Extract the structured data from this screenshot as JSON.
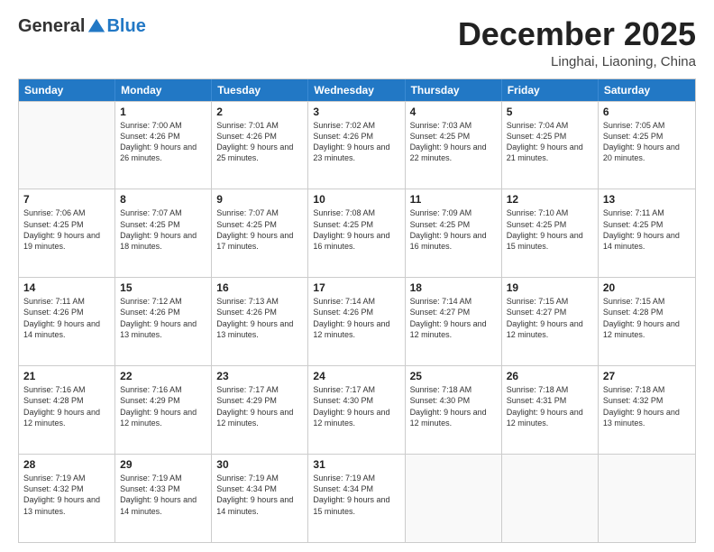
{
  "header": {
    "logo": {
      "general": "General",
      "blue": "Blue"
    },
    "title": "December 2025",
    "location": "Linghai, Liaoning, China"
  },
  "weekdays": [
    "Sunday",
    "Monday",
    "Tuesday",
    "Wednesday",
    "Thursday",
    "Friday",
    "Saturday"
  ],
  "weeks": [
    [
      {
        "day": null
      },
      {
        "day": "1",
        "sunrise": "7:00 AM",
        "sunset": "4:26 PM",
        "daylight": "9 hours and 26 minutes."
      },
      {
        "day": "2",
        "sunrise": "7:01 AM",
        "sunset": "4:26 PM",
        "daylight": "9 hours and 25 minutes."
      },
      {
        "day": "3",
        "sunrise": "7:02 AM",
        "sunset": "4:26 PM",
        "daylight": "9 hours and 23 minutes."
      },
      {
        "day": "4",
        "sunrise": "7:03 AM",
        "sunset": "4:25 PM",
        "daylight": "9 hours and 22 minutes."
      },
      {
        "day": "5",
        "sunrise": "7:04 AM",
        "sunset": "4:25 PM",
        "daylight": "9 hours and 21 minutes."
      },
      {
        "day": "6",
        "sunrise": "7:05 AM",
        "sunset": "4:25 PM",
        "daylight": "9 hours and 20 minutes."
      }
    ],
    [
      {
        "day": "7",
        "sunrise": "7:06 AM",
        "sunset": "4:25 PM",
        "daylight": "9 hours and 19 minutes."
      },
      {
        "day": "8",
        "sunrise": "7:07 AM",
        "sunset": "4:25 PM",
        "daylight": "9 hours and 18 minutes."
      },
      {
        "day": "9",
        "sunrise": "7:07 AM",
        "sunset": "4:25 PM",
        "daylight": "9 hours and 17 minutes."
      },
      {
        "day": "10",
        "sunrise": "7:08 AM",
        "sunset": "4:25 PM",
        "daylight": "9 hours and 16 minutes."
      },
      {
        "day": "11",
        "sunrise": "7:09 AM",
        "sunset": "4:25 PM",
        "daylight": "9 hours and 16 minutes."
      },
      {
        "day": "12",
        "sunrise": "7:10 AM",
        "sunset": "4:25 PM",
        "daylight": "9 hours and 15 minutes."
      },
      {
        "day": "13",
        "sunrise": "7:11 AM",
        "sunset": "4:25 PM",
        "daylight": "9 hours and 14 minutes."
      }
    ],
    [
      {
        "day": "14",
        "sunrise": "7:11 AM",
        "sunset": "4:26 PM",
        "daylight": "9 hours and 14 minutes."
      },
      {
        "day": "15",
        "sunrise": "7:12 AM",
        "sunset": "4:26 PM",
        "daylight": "9 hours and 13 minutes."
      },
      {
        "day": "16",
        "sunrise": "7:13 AM",
        "sunset": "4:26 PM",
        "daylight": "9 hours and 13 minutes."
      },
      {
        "day": "17",
        "sunrise": "7:14 AM",
        "sunset": "4:26 PM",
        "daylight": "9 hours and 12 minutes."
      },
      {
        "day": "18",
        "sunrise": "7:14 AM",
        "sunset": "4:27 PM",
        "daylight": "9 hours and 12 minutes."
      },
      {
        "day": "19",
        "sunrise": "7:15 AM",
        "sunset": "4:27 PM",
        "daylight": "9 hours and 12 minutes."
      },
      {
        "day": "20",
        "sunrise": "7:15 AM",
        "sunset": "4:28 PM",
        "daylight": "9 hours and 12 minutes."
      }
    ],
    [
      {
        "day": "21",
        "sunrise": "7:16 AM",
        "sunset": "4:28 PM",
        "daylight": "9 hours and 12 minutes."
      },
      {
        "day": "22",
        "sunrise": "7:16 AM",
        "sunset": "4:29 PM",
        "daylight": "9 hours and 12 minutes."
      },
      {
        "day": "23",
        "sunrise": "7:17 AM",
        "sunset": "4:29 PM",
        "daylight": "9 hours and 12 minutes."
      },
      {
        "day": "24",
        "sunrise": "7:17 AM",
        "sunset": "4:30 PM",
        "daylight": "9 hours and 12 minutes."
      },
      {
        "day": "25",
        "sunrise": "7:18 AM",
        "sunset": "4:30 PM",
        "daylight": "9 hours and 12 minutes."
      },
      {
        "day": "26",
        "sunrise": "7:18 AM",
        "sunset": "4:31 PM",
        "daylight": "9 hours and 12 minutes."
      },
      {
        "day": "27",
        "sunrise": "7:18 AM",
        "sunset": "4:32 PM",
        "daylight": "9 hours and 13 minutes."
      }
    ],
    [
      {
        "day": "28",
        "sunrise": "7:19 AM",
        "sunset": "4:32 PM",
        "daylight": "9 hours and 13 minutes."
      },
      {
        "day": "29",
        "sunrise": "7:19 AM",
        "sunset": "4:33 PM",
        "daylight": "9 hours and 14 minutes."
      },
      {
        "day": "30",
        "sunrise": "7:19 AM",
        "sunset": "4:34 PM",
        "daylight": "9 hours and 14 minutes."
      },
      {
        "day": "31",
        "sunrise": "7:19 AM",
        "sunset": "4:34 PM",
        "daylight": "9 hours and 15 minutes."
      },
      {
        "day": null
      },
      {
        "day": null
      },
      {
        "day": null
      }
    ]
  ]
}
